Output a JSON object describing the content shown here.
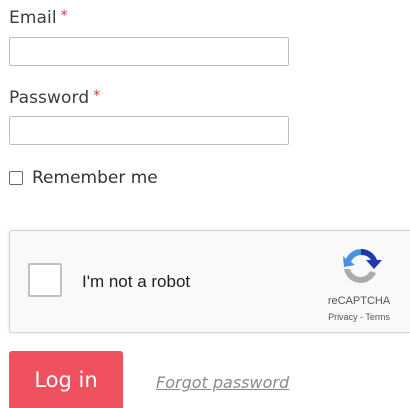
{
  "form": {
    "email_label": "Email",
    "email_required_mark": "*",
    "email_value": "",
    "password_label": "Password",
    "password_required_mark": "*",
    "password_value": "",
    "remember_label": "Remember me",
    "remember_checked": false
  },
  "recaptcha": {
    "label": "I'm not a robot",
    "brand": "reCAPTCHA",
    "privacy_link": "Privacy",
    "link_separator": " - ",
    "terms_link": "Terms",
    "logo_icon": "recaptcha-logo-icon"
  },
  "actions": {
    "login_label": "Log in",
    "forgot_label": "Forgot password"
  },
  "colors": {
    "required": "#d9363e",
    "login_button": "#f0515e",
    "link": "#8a8a8a"
  }
}
